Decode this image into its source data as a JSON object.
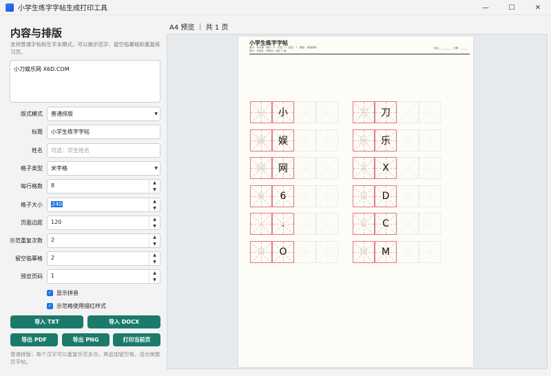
{
  "window": {
    "title": "小学生练字字帖生成打印工具",
    "minimize": "—",
    "maximize": "☐",
    "close": "✕"
  },
  "left": {
    "section_title": "内容与排版",
    "section_desc": "支持普通字帖和生字本模式。可以做示范字、留空临摹格和重复练习页。",
    "content_text": "小刀娱乐网 X6D.COM",
    "fields": {
      "layout_mode": {
        "label": "版式模式",
        "value": "普通排版"
      },
      "title": {
        "label": "标题",
        "value": "小学生练字字帖"
      },
      "name": {
        "label": "姓名",
        "placeholder": "可选：学生姓名"
      },
      "grid_type": {
        "label": "格子类型",
        "value": "米字格"
      },
      "per_row": {
        "label": "每行格数",
        "value": "8"
      },
      "cell_size": {
        "label": "格子大小",
        "value": "240"
      },
      "margin": {
        "label": "页面边距",
        "value": "120"
      },
      "repeat": {
        "label": "示范重复次数",
        "value": "2"
      },
      "blank": {
        "label": "留空临摹格",
        "value": "2"
      },
      "page": {
        "label": "预览页码",
        "value": "1"
      }
    },
    "checks": {
      "pinyin": {
        "label": "显示拼音",
        "checked": true
      },
      "red_style": {
        "label": "示范格使用描红样式",
        "checked": true
      }
    },
    "buttons": {
      "import_txt": "导入 TXT",
      "import_docx": "导入 DOCX",
      "export_pdf": "导出 PDF",
      "export_png": "导出 PNG",
      "print_page": "打印当前页"
    },
    "footer_note": "普通排版：每个汉字可以重复示范多次，再追加留空格，适合做整页字帖。"
  },
  "preview": {
    "title": "A4 预览 ｜ 共 1 页",
    "page": {
      "title": "小学生练字字帖",
      "sub1": "格子：米字格　每行：8　示范：2　留空：2　模板：普通排版",
      "sub2": "提示：先描红，再临写；每字 2 遍",
      "name_label": "姓名：________　日期：______"
    },
    "rows": [
      {
        "left": "小",
        "right": "刀"
      },
      {
        "left": "娱",
        "right": "乐"
      },
      {
        "left": "网",
        "right": "X"
      },
      {
        "left": "6",
        "right": "D"
      },
      {
        "left": ".",
        "right": "C"
      },
      {
        "left": "O",
        "right": "M"
      }
    ]
  }
}
